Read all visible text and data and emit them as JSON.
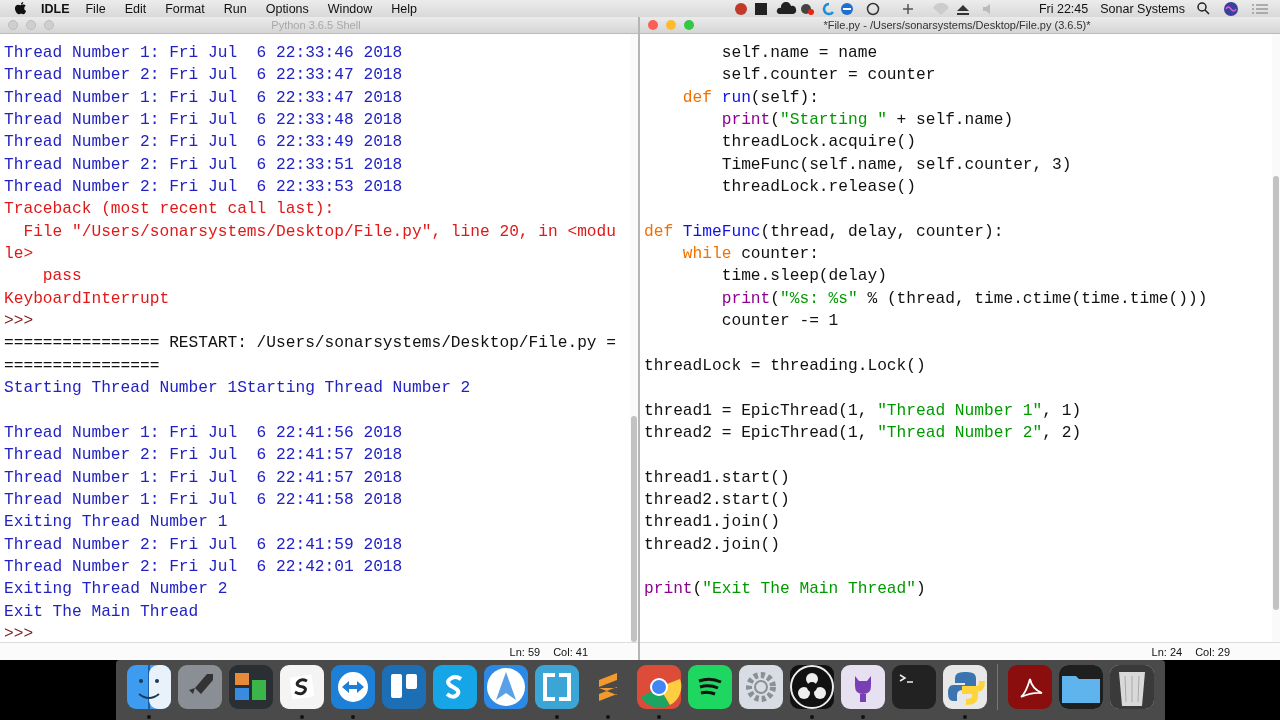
{
  "menubar": {
    "app_name": "IDLE",
    "menus": [
      "File",
      "Edit",
      "Format",
      "Run",
      "Options",
      "Window",
      "Help"
    ],
    "clock": "Fri 22:45",
    "user": "Sonar Systems"
  },
  "shell": {
    "title": "Python 3.6.5 Shell",
    "active": false,
    "lines": [
      {
        "kind": "output",
        "text": "Thread Number 1: Fri Jul  6 22:33:46 2018"
      },
      {
        "kind": "output",
        "text": "Thread Number 2: Fri Jul  6 22:33:47 2018"
      },
      {
        "kind": "output",
        "text": "Thread Number 1: Fri Jul  6 22:33:47 2018"
      },
      {
        "kind": "output",
        "text": "Thread Number 1: Fri Jul  6 22:33:48 2018"
      },
      {
        "kind": "output",
        "text": "Thread Number 2: Fri Jul  6 22:33:49 2018"
      },
      {
        "kind": "output",
        "text": "Thread Number 2: Fri Jul  6 22:33:51 2018"
      },
      {
        "kind": "output",
        "text": "Thread Number 2: Fri Jul  6 22:33:53 2018"
      },
      {
        "kind": "error",
        "text": "Traceback (most recent call last):"
      },
      {
        "kind": "error",
        "text": "  File \"/Users/sonarsystems/Desktop/File.py\", line 20, in <modu"
      },
      {
        "kind": "error",
        "text": "le>"
      },
      {
        "kind": "error",
        "text": "    pass"
      },
      {
        "kind": "error",
        "text": "KeyboardInterrupt"
      },
      {
        "kind": "prompt",
        "text": ">>>"
      },
      {
        "kind": "plain",
        "text": "================ RESTART: /Users/sonarsystems/Desktop/File.py ="
      },
      {
        "kind": "plain",
        "text": "================"
      },
      {
        "kind": "output",
        "text": "Starting Thread Number 1Starting Thread Number 2"
      },
      {
        "kind": "blank"
      },
      {
        "kind": "output",
        "text": "Thread Number 1: Fri Jul  6 22:41:56 2018"
      },
      {
        "kind": "output",
        "text": "Thread Number 2: Fri Jul  6 22:41:57 2018"
      },
      {
        "kind": "output",
        "text": "Thread Number 1: Fri Jul  6 22:41:57 2018"
      },
      {
        "kind": "output",
        "text": "Thread Number 1: Fri Jul  6 22:41:58 2018"
      },
      {
        "kind": "output",
        "text": "Exiting Thread Number 1"
      },
      {
        "kind": "output",
        "text": "Thread Number 2: Fri Jul  6 22:41:59 2018"
      },
      {
        "kind": "output",
        "text": "Thread Number 2: Fri Jul  6 22:42:01 2018"
      },
      {
        "kind": "output",
        "text": "Exiting Thread Number 2"
      },
      {
        "kind": "output",
        "text": "Exit The Main Thread"
      },
      {
        "kind": "prompt",
        "text": ">>>"
      }
    ],
    "status": {
      "line": "Ln: 59",
      "col": "Col: 41"
    }
  },
  "editor": {
    "title": "*File.py - /Users/sonarsystems/Desktop/File.py (3.6.5)*",
    "active": true,
    "lines": [
      {
        "kind": "code",
        "tokens": [
          {
            "kind": "plain",
            "text": "        self.name = name"
          }
        ]
      },
      {
        "kind": "code",
        "tokens": [
          {
            "kind": "plain",
            "text": "        self.counter = counter"
          }
        ]
      },
      {
        "kind": "code",
        "tokens": [
          {
            "kind": "keyword",
            "text": "    def"
          },
          {
            "kind": "defname",
            "text": " run"
          },
          {
            "kind": "plain",
            "text": "(self):"
          }
        ]
      },
      {
        "kind": "code",
        "tokens": [
          {
            "kind": "builtin",
            "text": "        print"
          },
          {
            "kind": "plain",
            "text": "("
          },
          {
            "kind": "string",
            "text": "\"Starting \""
          },
          {
            "kind": "plain",
            "text": " + self.name)"
          }
        ]
      },
      {
        "kind": "code",
        "tokens": [
          {
            "kind": "plain",
            "text": "        threadLock.acquire()"
          }
        ]
      },
      {
        "kind": "code",
        "tokens": [
          {
            "kind": "plain",
            "text": "        TimeFunc(self.name, self.counter, 3)"
          }
        ]
      },
      {
        "kind": "code",
        "tokens": [
          {
            "kind": "plain",
            "text": "        threadLock.release()"
          }
        ]
      },
      {
        "kind": "blank"
      },
      {
        "kind": "code",
        "tokens": [
          {
            "kind": "keyword",
            "text": "def"
          },
          {
            "kind": "defname",
            "text": " TimeFunc"
          },
          {
            "kind": "plain",
            "text": "(thread, delay, counter):"
          }
        ]
      },
      {
        "kind": "code",
        "tokens": [
          {
            "kind": "keyword",
            "text": "    while"
          },
          {
            "kind": "plain",
            "text": " counter:"
          }
        ]
      },
      {
        "kind": "code",
        "tokens": [
          {
            "kind": "plain",
            "text": "        time.sleep(delay)"
          }
        ]
      },
      {
        "kind": "code",
        "tokens": [
          {
            "kind": "builtin",
            "text": "        print"
          },
          {
            "kind": "plain",
            "text": "("
          },
          {
            "kind": "string",
            "text": "\"%s: %s\""
          },
          {
            "kind": "plain",
            "text": " % (thread, time.ctime(time.time()))"
          }
        ]
      },
      {
        "kind": "code",
        "tokens": [
          {
            "kind": "plain",
            "text": "        counter -= 1"
          }
        ]
      },
      {
        "kind": "blank"
      },
      {
        "kind": "code",
        "tokens": [
          {
            "kind": "plain",
            "text": "threadLock = threading.Lock()"
          }
        ]
      },
      {
        "kind": "blank"
      },
      {
        "kind": "code",
        "tokens": [
          {
            "kind": "plain",
            "text": "thread1 = EpicThread(1, "
          },
          {
            "kind": "string",
            "text": "\"Thread Number 1\""
          },
          {
            "kind": "plain",
            "text": ", 1)"
          }
        ]
      },
      {
        "kind": "code",
        "tokens": [
          {
            "kind": "plain",
            "text": "thread2 = EpicThread(1, "
          },
          {
            "kind": "string",
            "text": "\"Thread Number 2\""
          },
          {
            "kind": "plain",
            "text": ", 2)"
          }
        ]
      },
      {
        "kind": "blank"
      },
      {
        "kind": "code",
        "tokens": [
          {
            "kind": "plain",
            "text": "thread1.start()"
          }
        ]
      },
      {
        "kind": "code",
        "tokens": [
          {
            "kind": "plain",
            "text": "thread2.start()"
          }
        ]
      },
      {
        "kind": "code",
        "tokens": [
          {
            "kind": "plain",
            "text": "thread1.join()"
          }
        ]
      },
      {
        "kind": "code",
        "tokens": [
          {
            "kind": "plain",
            "text": "thread2.join()"
          }
        ]
      },
      {
        "kind": "blank"
      },
      {
        "kind": "code",
        "tokens": [
          {
            "kind": "builtin",
            "text": "print"
          },
          {
            "kind": "plain",
            "text": "("
          },
          {
            "kind": "string",
            "text": "\"Exit The Main Thread\""
          },
          {
            "kind": "plain",
            "text": ")"
          }
        ]
      }
    ],
    "status": {
      "line": "Ln: 24",
      "col": "Col: 29"
    }
  },
  "dock": [
    {
      "kind": "finder",
      "running": true
    },
    {
      "kind": "launchpad",
      "running": false
    },
    {
      "kind": "mission",
      "running": false
    },
    {
      "kind": "slack",
      "running": true
    },
    {
      "kind": "teamviewer",
      "running": true
    },
    {
      "kind": "trello",
      "running": false
    },
    {
      "kind": "skype",
      "running": false
    },
    {
      "kind": "spark",
      "running": false
    },
    {
      "kind": "parallels",
      "running": true
    },
    {
      "kind": "sublime",
      "running": true
    },
    {
      "kind": "chrome",
      "running": true
    },
    {
      "kind": "spotify",
      "running": false
    },
    {
      "kind": "preferences",
      "running": false
    },
    {
      "kind": "obs",
      "running": true
    },
    {
      "kind": "github",
      "running": true
    },
    {
      "kind": "terminal",
      "running": false
    },
    {
      "kind": "python",
      "running": true
    },
    {
      "kind": "separator"
    },
    {
      "kind": "acrobat",
      "running": false
    },
    {
      "kind": "folder",
      "running": false
    },
    {
      "kind": "trash",
      "running": false
    }
  ]
}
